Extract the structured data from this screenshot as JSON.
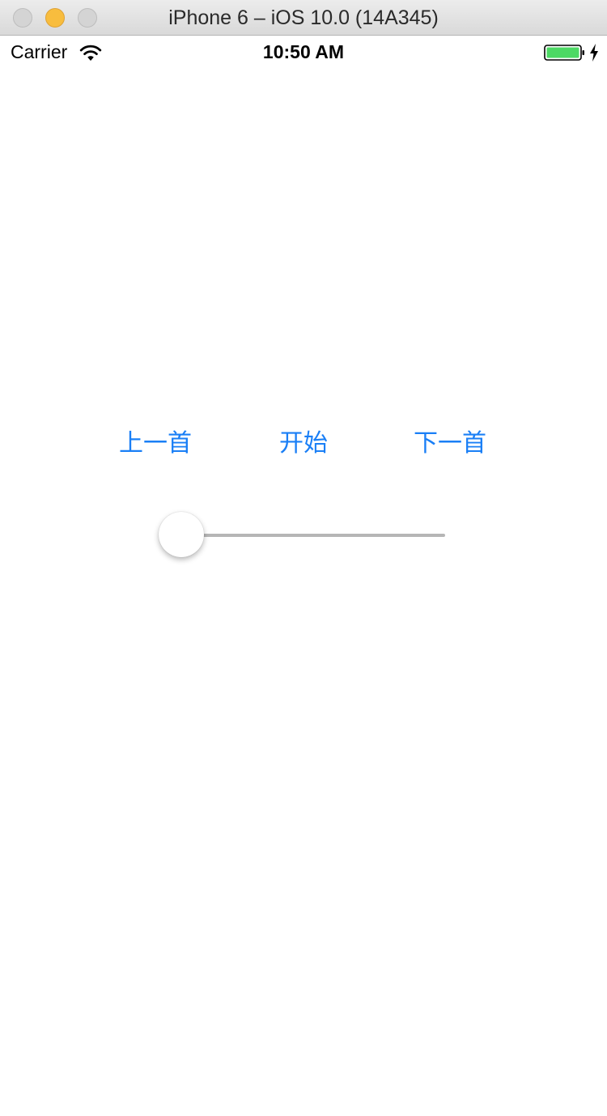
{
  "window": {
    "title": "iPhone 6 – iOS 10.0 (14A345)"
  },
  "status_bar": {
    "carrier": "Carrier",
    "time": "10:50 AM",
    "icons": [
      "wifi-icon",
      "battery-icon",
      "charging-icon"
    ],
    "battery_color": "#4cd964"
  },
  "controls": {
    "prev_label": "上一首",
    "start_label": "开始",
    "next_label": "下一首",
    "accent_color": "#1a7ff6"
  },
  "slider": {
    "value": 0.0
  }
}
